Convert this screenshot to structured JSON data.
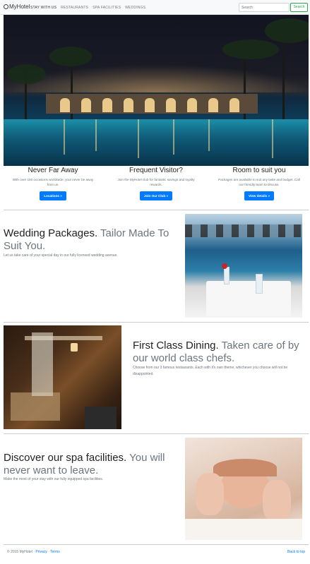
{
  "navbar": {
    "brand": "MyHotel",
    "links": [
      "STAY WITH US",
      "RESTAURANTS",
      "SPA FACILITIES",
      "WEDDINGS"
    ],
    "search_placeholder": "Search",
    "search_button": "Search"
  },
  "hero": {
    "image": "night-pool-resort-photo"
  },
  "columns": [
    {
      "title": "Never Far Away",
      "text": "With over 150 occasions worldwide, your never be away from us.",
      "button": "Locations »"
    },
    {
      "title": "Frequent Visitor?",
      "text": "Join the MyHotel club for fantastic savings and loyalty rewards.",
      "button": "Join Our Club »"
    },
    {
      "title": "Room to suit you",
      "text": "Packages are available to suit any taste and budget. Call our friendly team to discuss.",
      "button": "View details »"
    }
  ],
  "featurettes": [
    {
      "heading": "Wedding Packages.",
      "heading_muted": "Tailor Made To Suit You.",
      "lead": "Let us take care of your special day in our fully licensed wedding avenue.",
      "image": "wedding-table-photo"
    },
    {
      "heading": "First Class Dining.",
      "heading_muted": "Taken care of by our world class chefs.",
      "lead": "Choose from our 3 famous restaurants. Each with it's own theme, whichever you choose will not be disappointed.",
      "image": "restaurant-interior-photo"
    },
    {
      "heading": "Discover our spa facilities.",
      "heading_muted": "You will never want to leave.",
      "lead": "Make the most of your stay with our fully equipped spa facilities.",
      "image": "spa-massage-photo"
    }
  ],
  "footer": {
    "copyright": "© 2015 MyHotel ·",
    "privacy": "Privacy",
    "separator": "·",
    "terms": "Terms",
    "back_to_top": "Back to top"
  },
  "colors": {
    "primary": "#007bff",
    "success": "#28a745",
    "muted": "#6c757d"
  }
}
